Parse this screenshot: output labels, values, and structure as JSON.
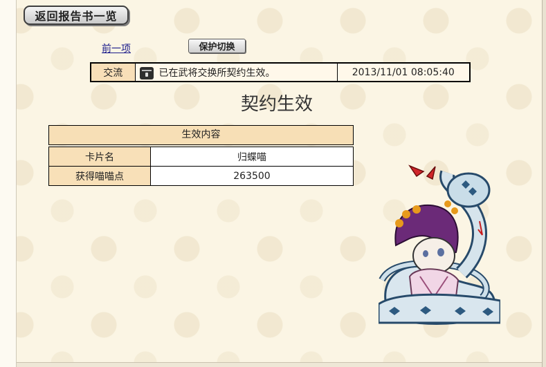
{
  "nav": {
    "back_label": "返回报告书一览",
    "prev_label": "前一项",
    "protect_label": "保护切换"
  },
  "report": {
    "type": "交流",
    "icon": "chest-icon",
    "message": "已在武将交换所契约生效。",
    "timestamp": "2013/11/01 08:05:40"
  },
  "page": {
    "title": "契约生效"
  },
  "effect": {
    "header": "生效内容",
    "rows": [
      {
        "key": "卡片名",
        "value": "归蝶喵"
      },
      {
        "key": "获得喵喵点",
        "value": "263500"
      }
    ]
  },
  "card": {
    "image": "cat-princess-with-snake-illustration"
  },
  "colors": {
    "label_bg": "#f8e0b8",
    "page_bg": "#fbf5e4"
  }
}
